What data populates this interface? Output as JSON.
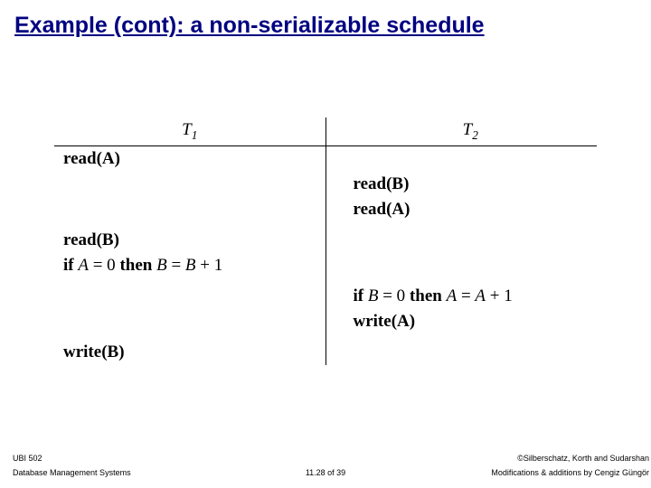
{
  "title": "Example (cont): a non-serializable schedule",
  "schedule": {
    "t1_header": "T",
    "t1_sub": "1",
    "t2_header": "T",
    "t2_sub": "2",
    "rows": {
      "r1c1": "read(A)",
      "r2c2": "read(B)",
      "r3c2": "read(A)",
      "r4c1": "read(B)",
      "r5c1": "if A = 0 then B = B + 1",
      "r6c2": "if B = 0 then A = A + 1",
      "r7c2": "write(A)",
      "r8c1": "write(B)"
    }
  },
  "footer": {
    "course": "UBI 502",
    "system": "Database Management Systems",
    "page": "11.28 of 39",
    "copyright": "©Silberschatz, Korth and Sudarshan",
    "mods": "Modifications & additions by Cengiz Güngör"
  }
}
